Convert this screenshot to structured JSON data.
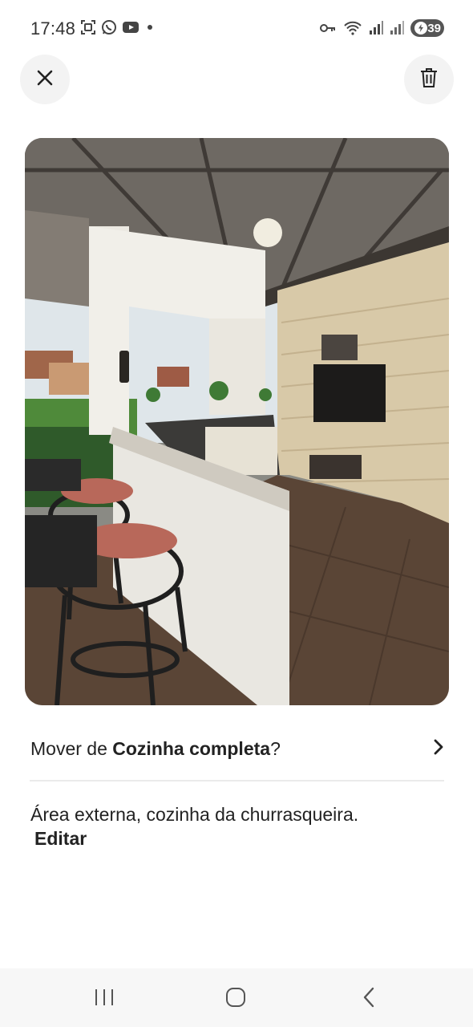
{
  "status_bar": {
    "time": "17:48",
    "battery_level": "39",
    "left_icons": [
      "screenshot-icon",
      "whatsapp-icon",
      "youtube-icon",
      "dot-icon"
    ],
    "right_icons": [
      "vpn-key-icon",
      "wifi-icon",
      "signal-icon",
      "signal-icon",
      "battery-icon"
    ]
  },
  "header": {
    "close_icon": "close-icon",
    "delete_icon": "trash-icon"
  },
  "photo": {
    "subject": "photo-outdoor-barbecue-kitchen"
  },
  "move_row": {
    "prefix": "Mover de ",
    "room_name": "Cozinha completa",
    "suffix": "?",
    "chevron_icon": "chevron-right-icon"
  },
  "caption": {
    "text": "Área externa, cozinha da churrasqueira.",
    "edit_label": "Editar"
  },
  "nav_bar": {
    "items": [
      "recents-icon",
      "home-icon",
      "back-icon"
    ]
  },
  "colors": {
    "text": "#222222",
    "button_bg": "#f3f3f3",
    "divider": "#ebebeb",
    "nav_bg": "#f7f7f7"
  }
}
